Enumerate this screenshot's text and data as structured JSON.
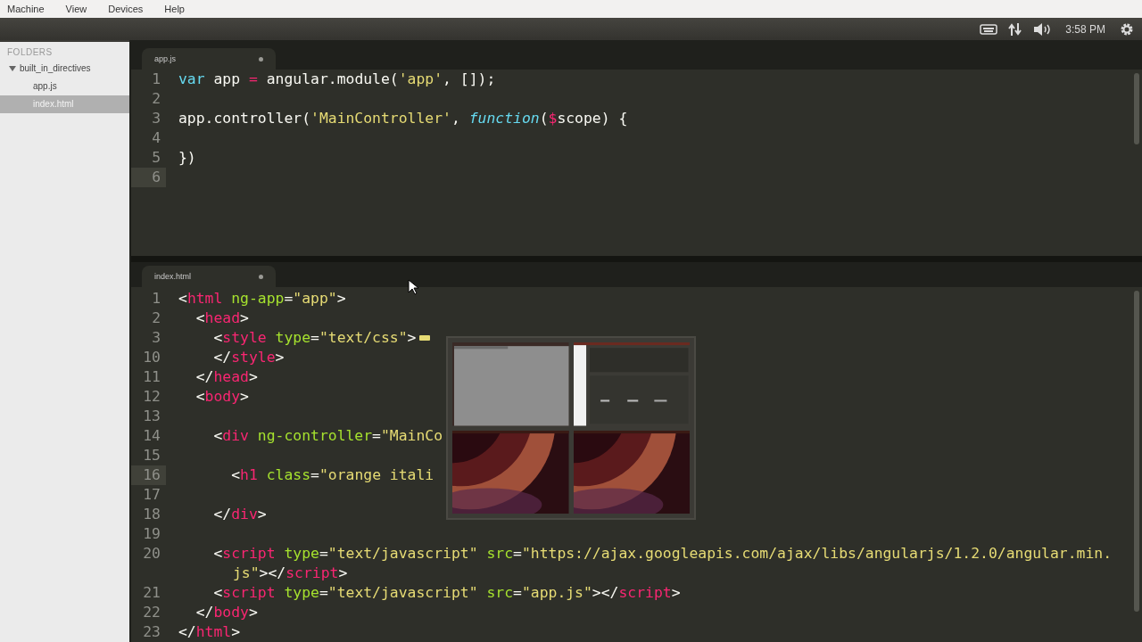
{
  "menubar": {
    "items": [
      "Machine",
      "View",
      "Devices",
      "Help"
    ]
  },
  "panel": {
    "time": "3:58 PM"
  },
  "sidebar": {
    "heading": "FOLDERS",
    "tree": [
      {
        "label": "built_in_directives",
        "expanded": true,
        "selected": false,
        "children": [
          {
            "label": "app.js",
            "selected": false
          },
          {
            "label": "index.html",
            "selected": true
          }
        ]
      }
    ]
  },
  "panes": [
    {
      "tab": {
        "label": "app.js"
      },
      "lines": [
        {
          "n": "1",
          "current": false,
          "t": [
            {
              "kind": "kw",
              "text": "var"
            },
            {
              "kind": "pl",
              "text": " app "
            },
            {
              "kind": "op",
              "text": "="
            },
            {
              "kind": "pl",
              "text": " angular.module("
            },
            {
              "kind": "str",
              "text": "'app'"
            },
            {
              "kind": "pl",
              "text": ", []);"
            }
          ]
        },
        {
          "n": "2",
          "current": false
        },
        {
          "n": "3",
          "current": false,
          "t": [
            {
              "kind": "pl",
              "text": "app.controller("
            },
            {
              "kind": "str",
              "text": "'MainController'"
            },
            {
              "kind": "pl",
              "text": ", "
            },
            {
              "kind": "kwi",
              "text": "function"
            },
            {
              "kind": "pl",
              "text": "("
            },
            {
              "kind": "op",
              "text": "$"
            },
            {
              "kind": "pl",
              "text": "scope) {"
            }
          ]
        },
        {
          "n": "4",
          "current": false
        },
        {
          "n": "5",
          "current": false,
          "t": [
            {
              "kind": "pl",
              "text": "})"
            }
          ]
        },
        {
          "n": "6",
          "current": true
        }
      ]
    },
    {
      "tab": {
        "label": "index.html"
      },
      "lines": [
        {
          "n": "1",
          "current": false,
          "t": [
            {
              "kind": "pl",
              "text": "<"
            },
            {
              "kind": "tag",
              "text": "html"
            },
            {
              "kind": "attr",
              "text": " ng-app"
            },
            {
              "kind": "pl",
              "text": "="
            },
            {
              "kind": "str",
              "text": "\"app\""
            },
            {
              "kind": "pl",
              "text": ">"
            }
          ]
        },
        {
          "n": "2",
          "current": false,
          "t": [
            {
              "kind": "pl",
              "text": "  <"
            },
            {
              "kind": "tag",
              "text": "head"
            },
            {
              "kind": "pl",
              "text": ">"
            }
          ]
        },
        {
          "n": "3",
          "current": false,
          "folded": true,
          "t": [
            {
              "kind": "pl",
              "text": "    <"
            },
            {
              "kind": "tag",
              "text": "style"
            },
            {
              "kind": "attr",
              "text": " type"
            },
            {
              "kind": "pl",
              "text": "="
            },
            {
              "kind": "str",
              "text": "\"text/css\""
            },
            {
              "kind": "pl",
              "text": ">"
            }
          ]
        },
        {
          "n": "10",
          "current": false,
          "t": [
            {
              "kind": "pl",
              "text": "    </"
            },
            {
              "kind": "tag",
              "text": "style"
            },
            {
              "kind": "pl",
              "text": ">"
            }
          ]
        },
        {
          "n": "11",
          "current": false,
          "t": [
            {
              "kind": "pl",
              "text": "  </"
            },
            {
              "kind": "tag",
              "text": "head"
            },
            {
              "kind": "pl",
              "text": ">"
            }
          ]
        },
        {
          "n": "12",
          "current": false,
          "t": [
            {
              "kind": "pl",
              "text": "  <"
            },
            {
              "kind": "tag",
              "text": "body"
            },
            {
              "kind": "pl",
              "text": ">"
            }
          ]
        },
        {
          "n": "13",
          "current": false
        },
        {
          "n": "14",
          "current": false,
          "t": [
            {
              "kind": "pl",
              "text": "    <"
            },
            {
              "kind": "tag",
              "text": "div"
            },
            {
              "kind": "attr",
              "text": " ng-controller"
            },
            {
              "kind": "pl",
              "text": "="
            },
            {
              "kind": "str",
              "text": "\"MainCo"
            }
          ]
        },
        {
          "n": "15",
          "current": false
        },
        {
          "n": "16",
          "current": true,
          "t": [
            {
              "kind": "pl",
              "text": "      <"
            },
            {
              "kind": "tag",
              "text": "h1"
            },
            {
              "kind": "attr",
              "text": " class"
            },
            {
              "kind": "pl",
              "text": "="
            },
            {
              "kind": "str",
              "text": "\"orange itali"
            }
          ]
        },
        {
          "n": "17",
          "current": false
        },
        {
          "n": "18",
          "current": false,
          "t": [
            {
              "kind": "pl",
              "text": "    </"
            },
            {
              "kind": "tag",
              "text": "div"
            },
            {
              "kind": "pl",
              "text": ">"
            }
          ]
        },
        {
          "n": "19",
          "current": false
        },
        {
          "n": "20",
          "current": false,
          "t": [
            {
              "kind": "pl",
              "text": "    <"
            },
            {
              "kind": "tag",
              "text": "script"
            },
            {
              "kind": "attr",
              "text": " type"
            },
            {
              "kind": "pl",
              "text": "="
            },
            {
              "kind": "str",
              "text": "\"text/javascript\""
            },
            {
              "kind": "attr",
              "text": " src"
            },
            {
              "kind": "pl",
              "text": "="
            },
            {
              "kind": "str",
              "text": "\"https://ajax.googleapis.com/ajax/libs/angularjs/1.2.0/angular.min."
            }
          ],
          "wrap": [
            {
              "kind": "str",
              "text": "js\""
            },
            {
              "kind": "pl",
              "text": "></"
            },
            {
              "kind": "tag",
              "text": "script"
            },
            {
              "kind": "pl",
              "text": ">"
            }
          ]
        },
        {
          "n": "21",
          "current": false,
          "t": [
            {
              "kind": "pl",
              "text": "    <"
            },
            {
              "kind": "tag",
              "text": "script"
            },
            {
              "kind": "attr",
              "text": " type"
            },
            {
              "kind": "pl",
              "text": "="
            },
            {
              "kind": "str",
              "text": "\"text/javascript\""
            },
            {
              "kind": "attr",
              "text": " src"
            },
            {
              "kind": "pl",
              "text": "="
            },
            {
              "kind": "str",
              "text": "\"app.js\""
            },
            {
              "kind": "pl",
              "text": "></"
            },
            {
              "kind": "tag",
              "text": "script"
            },
            {
              "kind": "pl",
              "text": ">"
            }
          ]
        },
        {
          "n": "22",
          "current": false,
          "t": [
            {
              "kind": "pl",
              "text": "  </"
            },
            {
              "kind": "tag",
              "text": "body"
            },
            {
              "kind": "pl",
              "text": ">"
            }
          ]
        },
        {
          "n": "23",
          "current": false,
          "t": [
            {
              "kind": "pl",
              "text": "</"
            },
            {
              "kind": "tag",
              "text": "html"
            },
            {
              "kind": "pl",
              "text": ">"
            }
          ]
        }
      ]
    }
  ]
}
